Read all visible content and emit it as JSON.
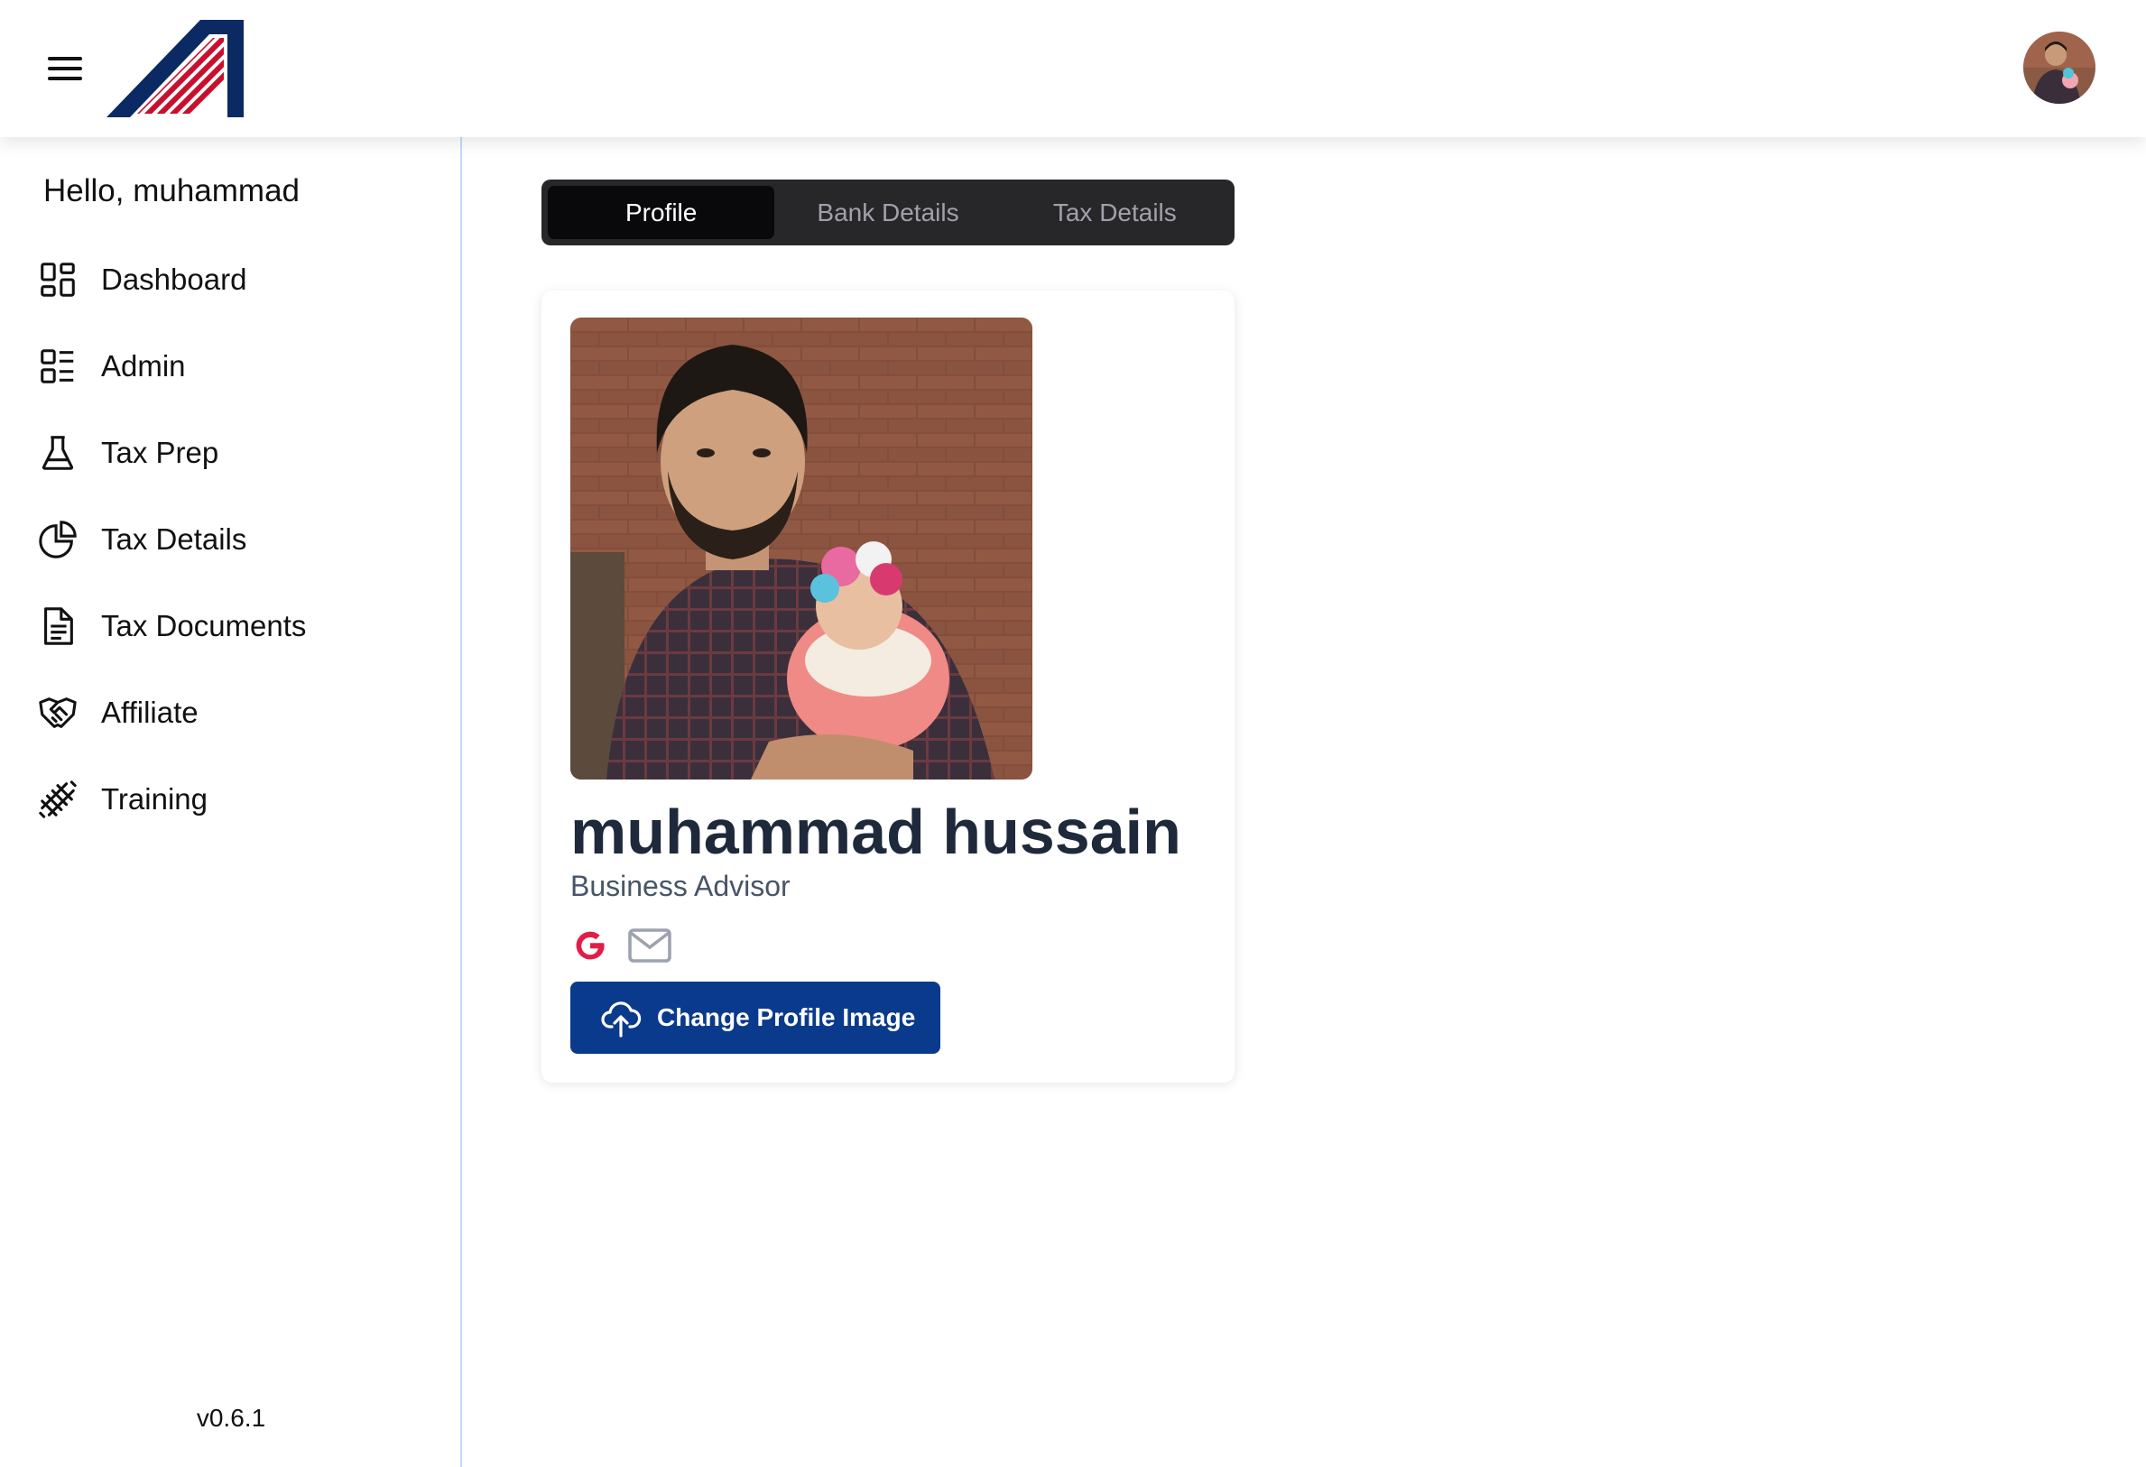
{
  "header": {
    "menu_icon": "hamburger-menu-icon",
    "logo": "brand-logo",
    "avatar": "user-avatar"
  },
  "sidebar": {
    "greeting": "Hello, muhammad",
    "items": [
      {
        "label": "Dashboard",
        "icon": "dashboard-icon"
      },
      {
        "label": "Admin",
        "icon": "admin-list-icon"
      },
      {
        "label": "Tax Prep",
        "icon": "flask-icon"
      },
      {
        "label": "Tax Details",
        "icon": "pie-chart-icon"
      },
      {
        "label": "Tax Documents",
        "icon": "document-icon"
      },
      {
        "label": "Affiliate",
        "icon": "handshake-icon"
      },
      {
        "label": "Training",
        "icon": "railway-icon"
      }
    ],
    "version": "v0.6.1"
  },
  "tabs": [
    {
      "label": "Profile",
      "active": true
    },
    {
      "label": "Bank Details",
      "active": false
    },
    {
      "label": "Tax Details",
      "active": false
    }
  ],
  "profile": {
    "name": "muhammad hussain",
    "role": "Business Advisor",
    "social_icons": [
      "google-icon",
      "mail-icon"
    ],
    "change_image_label": "Change Profile Image"
  },
  "colors": {
    "primary_button": "#0a3a8c",
    "tab_bg": "#27272a",
    "tab_active": "#09090b",
    "sidebar_border": "#bfdbfe",
    "google_red": "#e11d48"
  }
}
